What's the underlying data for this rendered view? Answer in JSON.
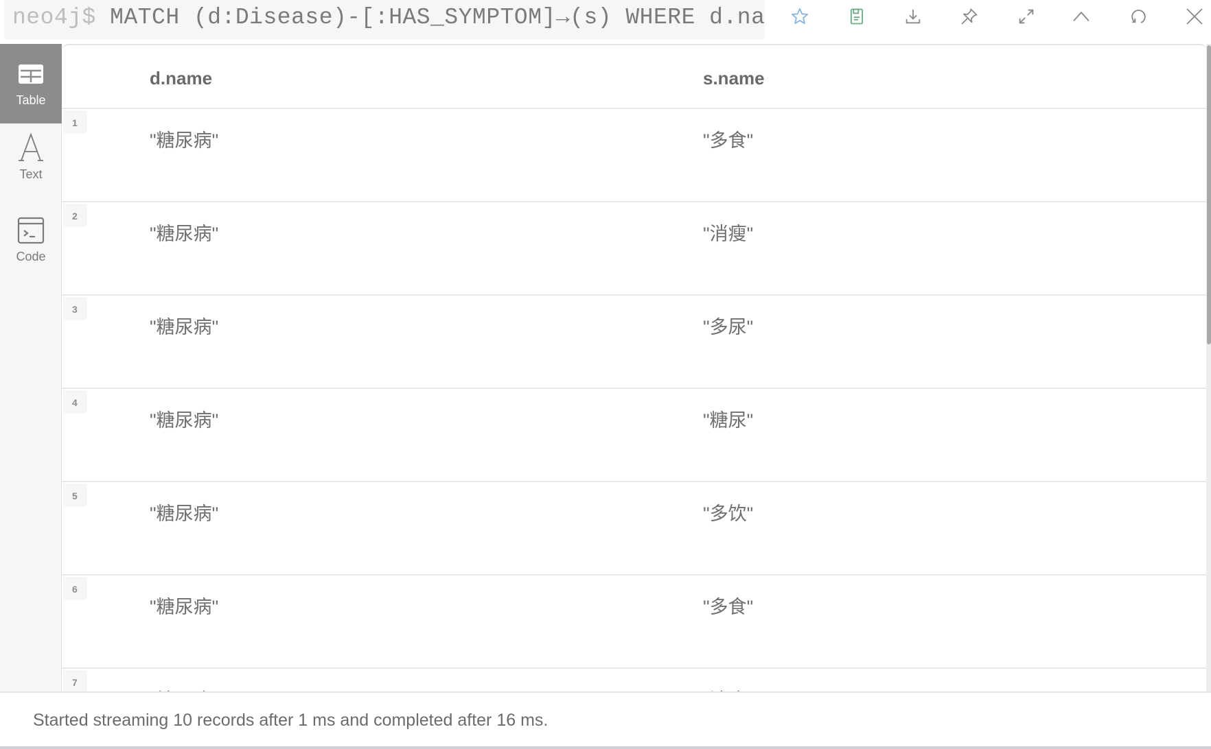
{
  "query_bar": {
    "prompt": "neo4j$",
    "query": "MATCH (d:Disease)-[:HAS_SYMPTOM]→(s) WHERE d.name…"
  },
  "toolbar": {
    "buttons": [
      {
        "name": "favorite",
        "icon": "star-icon",
        "color": "#8ab4e0"
      },
      {
        "name": "save",
        "icon": "save-icon",
        "color": "#6aaa84"
      },
      {
        "name": "download",
        "icon": "download-icon",
        "color": "#8a8a8a"
      },
      {
        "name": "pin",
        "icon": "pin-icon",
        "color": "#8a8a8a"
      },
      {
        "name": "fullscreen",
        "icon": "expand-icon",
        "color": "#8a8a8a"
      },
      {
        "name": "collapse",
        "icon": "chevron-up-icon",
        "color": "#8a8a8a"
      },
      {
        "name": "rerun",
        "icon": "refresh-icon",
        "color": "#8a8a8a"
      },
      {
        "name": "close",
        "icon": "close-icon",
        "color": "#8a8a8a"
      }
    ]
  },
  "sidebar": {
    "items": [
      {
        "label": "Table",
        "icon": "table-icon",
        "active": true
      },
      {
        "label": "Text",
        "icon": "text-icon",
        "active": false
      },
      {
        "label": "Code",
        "icon": "code-icon",
        "active": false
      }
    ]
  },
  "table": {
    "columns": [
      "d.name",
      "s.name"
    ],
    "rows": [
      {
        "num": "1",
        "d": "\"糖尿病\"",
        "s": "\"多食\""
      },
      {
        "num": "2",
        "d": "\"糖尿病\"",
        "s": "\"消瘦\""
      },
      {
        "num": "3",
        "d": "\"糖尿病\"",
        "s": "\"多尿\""
      },
      {
        "num": "4",
        "d": "\"糖尿病\"",
        "s": "\"糖尿\""
      },
      {
        "num": "5",
        "d": "\"糖尿病\"",
        "s": "\"多饮\""
      },
      {
        "num": "6",
        "d": "\"糖尿病\"",
        "s": "\"多食\""
      },
      {
        "num": "7",
        "d": "\"糖尿病\"",
        "s": "\"消瘦\""
      }
    ]
  },
  "footer": {
    "status": "Started streaming 10 records after 1 ms and completed after 16 ms."
  }
}
